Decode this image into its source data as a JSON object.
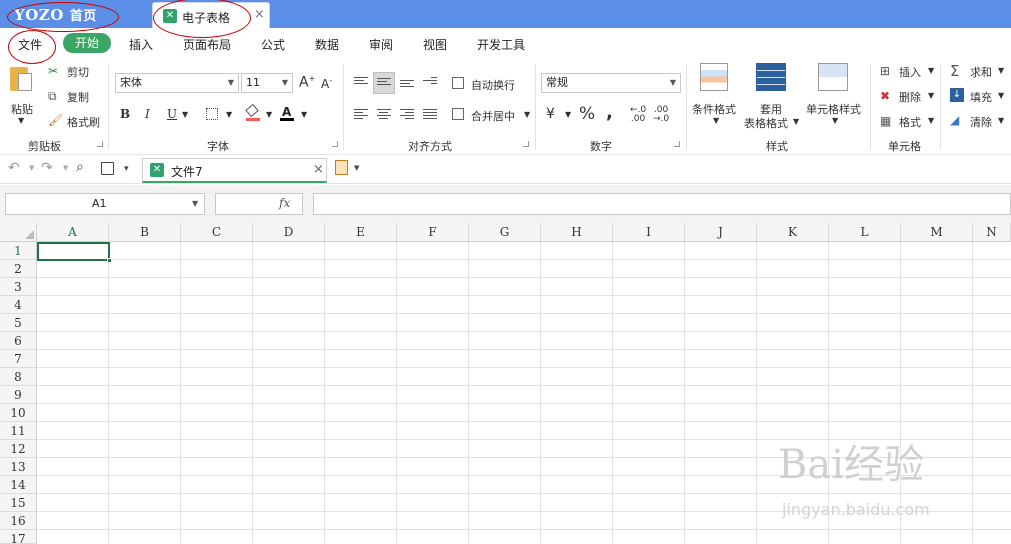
{
  "title_bar": {
    "brand": "YOZO",
    "home": "首页",
    "doc_tab": "电子表格",
    "close": "×"
  },
  "menu": {
    "file": "文件",
    "start": "开始",
    "insert": "插入",
    "page_layout": "页面布局",
    "formulas": "公式",
    "data": "数据",
    "review": "审阅",
    "view": "视图",
    "dev_tools": "开发工具"
  },
  "ribbon": {
    "clipboard": {
      "paste": "粘贴",
      "cut": "剪切",
      "copy": "复制",
      "format_painter": "格式刷",
      "label": "剪贴板"
    },
    "font": {
      "font_name": "宋体",
      "font_size": "11",
      "bold": "B",
      "italic": "I",
      "underline": "U",
      "grow": "A",
      "shrink": "A",
      "label": "字体"
    },
    "alignment": {
      "wrap": "自动换行",
      "merge": "合并居中",
      "label": "对齐方式"
    },
    "number": {
      "format": "常规",
      "currency": "¥",
      "percent": "%",
      "comma": ",",
      "inc_decimal": ".00",
      "dec_decimal": ".00",
      "label": "数字"
    },
    "styles": {
      "conditional": "条件格式",
      "table_line1": "套用",
      "table_line2": "表格格式",
      "cell_style": "单元格样式",
      "label": "样式"
    },
    "cells": {
      "insert": "插入",
      "delete": "删除",
      "format": "格式",
      "label": "单元格"
    },
    "editing": {
      "sum": "求和",
      "fill": "填充",
      "clear": "清除"
    }
  },
  "qat": {
    "file_tab": "文件7",
    "close": "×"
  },
  "formula_bar": {
    "name_box": "A1",
    "fx": "fx",
    "value": ""
  },
  "grid": {
    "columns": [
      "A",
      "B",
      "C",
      "D",
      "E",
      "F",
      "G",
      "H",
      "I",
      "J",
      "K",
      "L",
      "M",
      "N"
    ],
    "rows": [
      "1",
      "2",
      "3",
      "4",
      "5",
      "6",
      "7",
      "8",
      "9",
      "10",
      "11",
      "12",
      "13",
      "14",
      "15",
      "16",
      "17"
    ],
    "active_cell": "A1"
  },
  "watermark": {
    "text": "Bai经验",
    "url": "jingyan.baidu.com"
  },
  "colors": {
    "title_bar": "#5b8ee6",
    "accent_green": "#3aa564",
    "active_border": "#217346",
    "annotation": "#cc0000"
  }
}
